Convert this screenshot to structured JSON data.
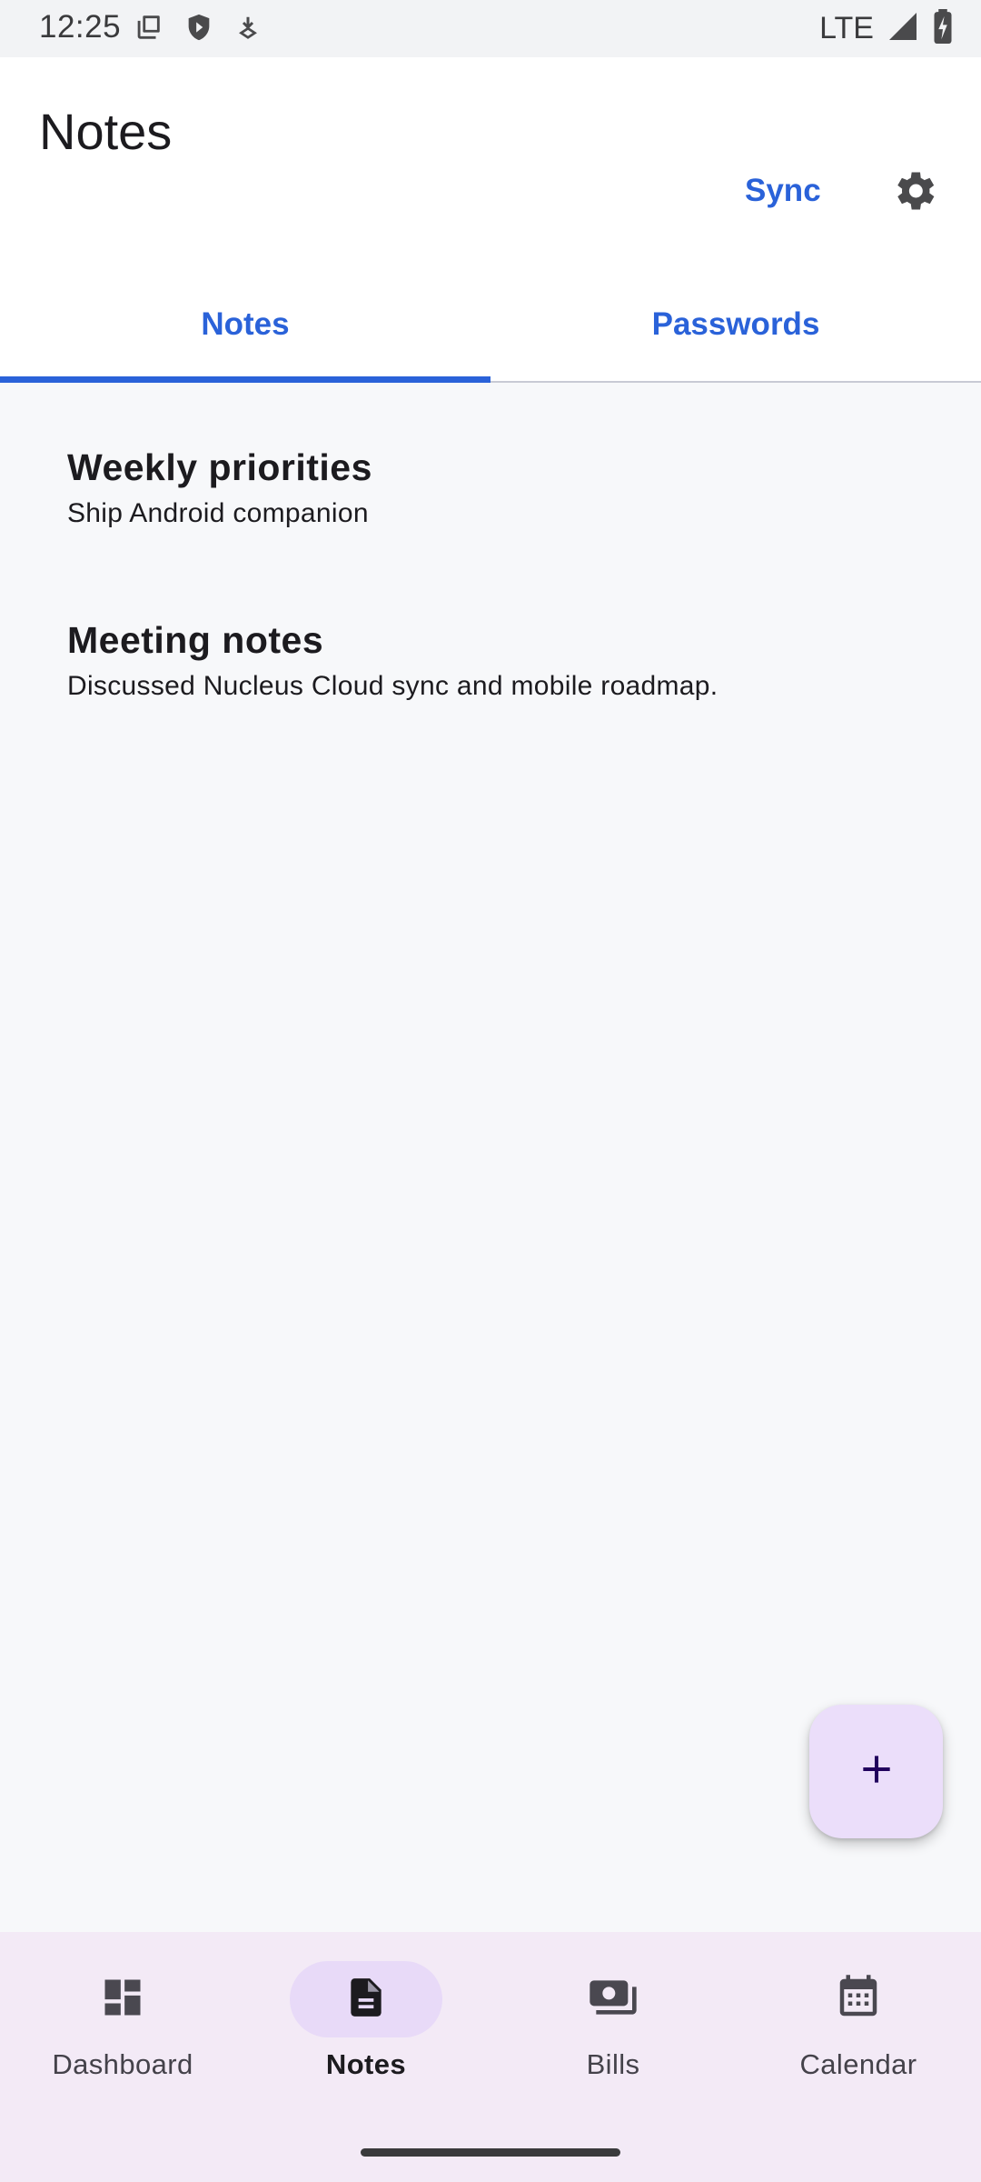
{
  "status_bar": {
    "time": "12:25",
    "network": "LTE",
    "left_icons": [
      "screenshot-icon",
      "shield-icon",
      "download-icon"
    ],
    "right_icons": [
      "signal-icon",
      "battery-charging-icon"
    ]
  },
  "app_bar": {
    "title": "Notes",
    "sync_label": "Sync",
    "settings_icon": "gear-icon"
  },
  "tabs": [
    {
      "label": "Notes",
      "active": true
    },
    {
      "label": "Passwords",
      "active": false
    }
  ],
  "notes": [
    {
      "title": "Weekly priorities",
      "body": "Ship Android companion"
    },
    {
      "title": "Meeting notes",
      "body": "Discussed Nucleus Cloud sync and mobile roadmap."
    }
  ],
  "fab": {
    "icon": "plus-icon"
  },
  "bottom_nav": [
    {
      "label": "Dashboard",
      "icon": "dashboard-icon",
      "active": false
    },
    {
      "label": "Notes",
      "icon": "note-icon",
      "active": true
    },
    {
      "label": "Bills",
      "icon": "bills-icon",
      "active": false
    },
    {
      "label": "Calendar",
      "icon": "calendar-icon",
      "active": false
    }
  ],
  "colors": {
    "accent": "#2a62d9",
    "fab_background": "#ebdefa",
    "nav_background": "#f3eaf6",
    "nav_active_pill": "#e8daf8"
  }
}
